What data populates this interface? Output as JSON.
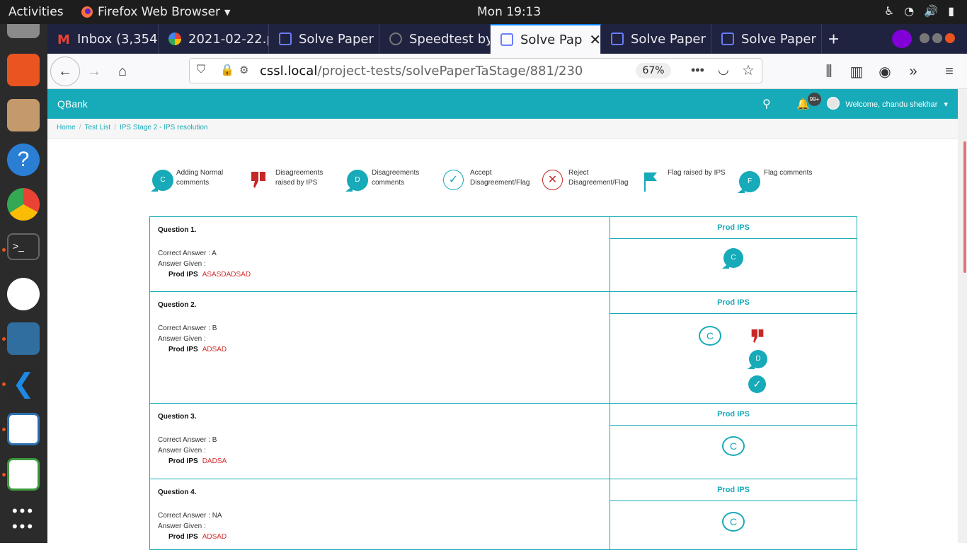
{
  "system": {
    "activities": "Activities",
    "app_name": "Firefox Web Browser",
    "clock": "Mon 19:13"
  },
  "tabs": [
    {
      "label": "Inbox (3,354",
      "icon": "gmail-icon"
    },
    {
      "label": "2021-02-22.p",
      "icon": "photos-icon"
    },
    {
      "label": "Solve Paper",
      "icon": "page-icon"
    },
    {
      "label": "Speedtest by",
      "icon": "speedtest-icon"
    },
    {
      "label": "Solve Pap",
      "icon": "page-icon",
      "active": true
    },
    {
      "label": "Solve Paper",
      "icon": "page-icon"
    },
    {
      "label": "Solve Paper",
      "icon": "page-icon"
    }
  ],
  "browser": {
    "url_host": "cssl.local",
    "url_path": "/project-tests/solvePaperTaStage/881/230",
    "zoom": "67%"
  },
  "app": {
    "brand": "QBank",
    "notif_count": "99+",
    "welcome": "Welcome, chandu shekhar",
    "breadcrumb": [
      "Home",
      "Test List",
      "IPS Stage 2 - IPS resolution"
    ]
  },
  "legend": [
    {
      "line1": "Adding Normal",
      "line2": "comments"
    },
    {
      "line1": "Disagreements",
      "line2": "raised by IPS"
    },
    {
      "line1": "Disagreements",
      "line2": "comments"
    },
    {
      "line1": "Accept",
      "line2": "Disagreement/Flag"
    },
    {
      "line1": "Reject",
      "line2": "Disagreement/Flag"
    },
    {
      "line1": "",
      "line2": "Flag raised by IPS"
    },
    {
      "line1": "",
      "line2": "Flag comments"
    }
  ],
  "legend_icon_letters": {
    "comment": "C",
    "disagreement_comment": "D",
    "flag_comment": "F"
  },
  "questions": [
    {
      "title": "Question 1.",
      "correct": "Correct Answer : A",
      "given": "Answer Given :",
      "reviewer": "Prod IPS",
      "answer": "ASASDADSAD",
      "column": "Prod IPS",
      "marks": [
        "C"
      ]
    },
    {
      "title": "Question 2.",
      "correct": "Correct Answer : B",
      "given": "Answer Given :",
      "reviewer": "Prod IPS",
      "answer": "ADSAD",
      "column": "Prod IPS",
      "marks": [
        "C",
        "D"
      ]
    },
    {
      "title": "Question 3.",
      "correct": "Correct Answer : B",
      "given": "Answer Given :",
      "reviewer": "Prod IPS",
      "answer": "DADSA",
      "column": "Prod IPS",
      "marks": [
        "C"
      ]
    },
    {
      "title": "Question 4.",
      "correct": "Correct Answer : NA",
      "given": "Answer Given :",
      "reviewer": "Prod IPS",
      "answer": "ADSAD",
      "column": "Prod IPS",
      "marks": [
        "C"
      ]
    }
  ]
}
